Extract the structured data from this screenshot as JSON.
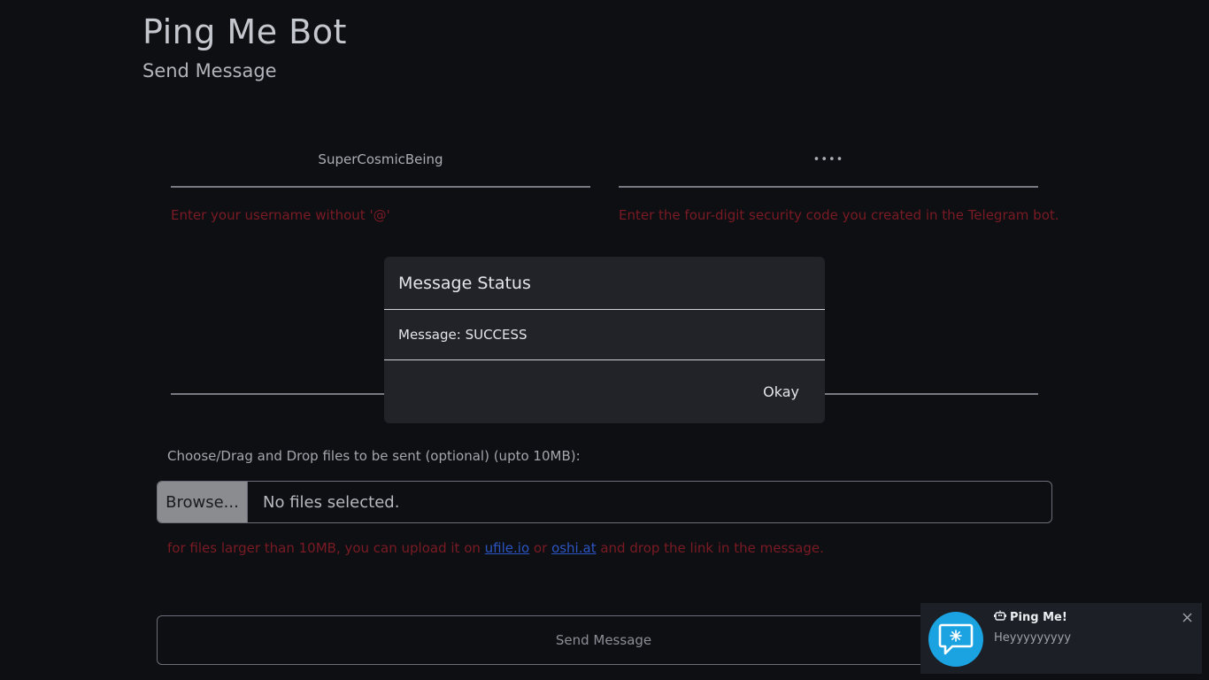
{
  "header": {
    "title": "Ping Me Bot",
    "subtitle": "Send Message"
  },
  "form": {
    "username": {
      "value": "SuperCosmicBeing",
      "hint": "Enter your username without '@'"
    },
    "security_code": {
      "value": "••••",
      "hint": "Enter the four-digit security code you created in the Telegram bot."
    },
    "file_upload": {
      "label": "Choose/Drag and Drop files to be sent (optional) (upto 10MB):",
      "browse_label": "Browse...",
      "status": "No files selected."
    },
    "upload_hint": {
      "prefix": "for files larger than 10MB, you can upload it on",
      "link1": "ufile.io",
      "middle": "or",
      "link2": "oshi.at",
      "suffix": "and drop the link in the message."
    },
    "send_label": "Send Message"
  },
  "modal": {
    "title": "Message Status",
    "body": "Message: SUCCESS",
    "okay_label": "Okay"
  },
  "notification": {
    "title": "Ping Me!",
    "message": "Heyyyyyyyyy",
    "icons": {
      "avatar": "chat-bubble-icon",
      "title": "bot-icon",
      "close": "close-icon"
    }
  },
  "colors": {
    "background": "#0e0f12",
    "hint_red": "#7a1a24",
    "link_blue": "#2c55c4",
    "modal_bg": "#212328",
    "toast_accent": "#1aa3e0"
  }
}
